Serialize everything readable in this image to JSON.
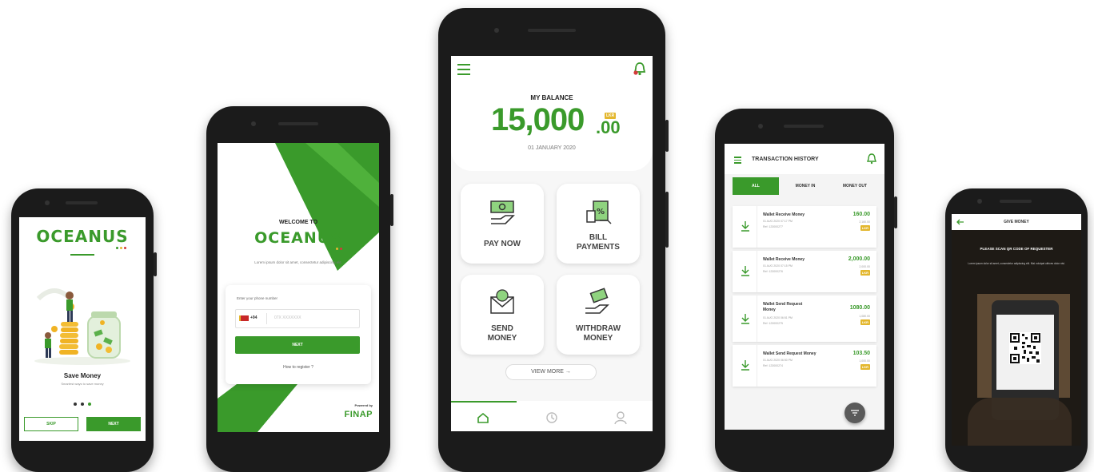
{
  "onboarding": {
    "logo": "OCEANUS",
    "title": "Save Money",
    "subtitle": "Smartest ways to save money",
    "skip_label": "SKIP",
    "next_label": "NEXT"
  },
  "login": {
    "welcome": "WELCOME TO",
    "logo": "OCEANUS",
    "description": "Lorem ipsum dolor sit amet, consectetur adipiscing elit.",
    "phone_label": "Enter your phone number",
    "country_code": "+94",
    "phone_placeholder": "07X XXXXXXX",
    "next_label": "NEXT",
    "register_link": "How to register ?",
    "powered_by": "Powered by",
    "brand": "FINAP"
  },
  "dashboard": {
    "balance_title": "MY BALANCE",
    "balance_main": "15,000",
    "balance_cents": ".00",
    "currency": "LKR",
    "date": "01 JANUARY 2020",
    "actions": [
      {
        "label": "PAY NOW"
      },
      {
        "label": "BILL PAYMENTS"
      },
      {
        "label": "SEND MONEY"
      },
      {
        "label": "WITHDRAW MONEY"
      }
    ],
    "view_more": "VIEW MORE →"
  },
  "history": {
    "title": "TRANSACTION HISTORY",
    "tabs": [
      "ALL",
      "MONEY IN",
      "MONEY OUT"
    ],
    "items": [
      {
        "title": "Wallet Receive Money",
        "date": "01 AUG 2020 07:17 PM",
        "ref": "Ref: 123000277",
        "amount": "160.00",
        "balance": "2,160.00",
        "status": "LKR"
      },
      {
        "title": "Wallet Receive Money",
        "date": "01 AUG 2020 07:15 PM",
        "ref": "Ref: 123000276",
        "amount": "2,000.00",
        "balance": "2,000.00",
        "status": "LKR"
      },
      {
        "title": "Wallet Send Request Money",
        "date": "01 AUG 2020 06:51 PM",
        "ref": "Ref: 123000275",
        "amount": "1080.00",
        "balance": "1,080.00",
        "status": "LKR"
      },
      {
        "title": "Wallet Send Request Money",
        "date": "01 AUG 2020 06:50 PM",
        "ref": "Ref: 123000274",
        "amount": "103.50",
        "balance": "1,000.00",
        "status": "LKR"
      }
    ]
  },
  "give_money": {
    "title": "GIVE MONEY",
    "instruction": "PLEASE SCAN QR CODE OF REQUESTER",
    "description": "Lorem ipsum dolor sit amet, consectetur adipiscing elit. Nisi volutpat ultrices dolor nisi."
  },
  "colors": {
    "brand": "#3a9a2b",
    "accent": "#e3b72e"
  }
}
